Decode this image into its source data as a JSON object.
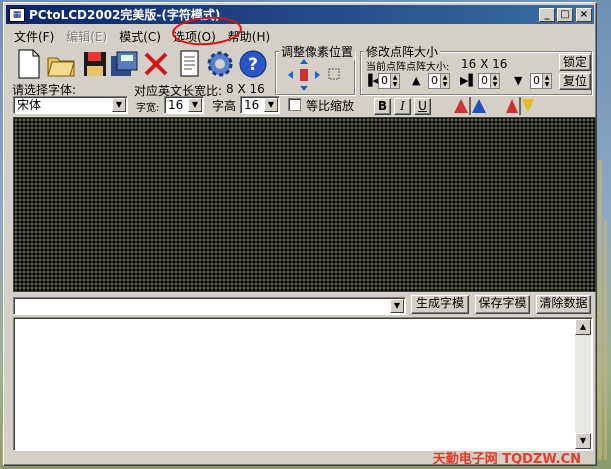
{
  "window": {
    "title": "PCtoLCD2002完美版-(字符模式)"
  },
  "titlebar": {
    "minimize": "_",
    "maximize": "□",
    "close": "×"
  },
  "menu": [
    {
      "label": "文件(F)",
      "disabled": false
    },
    {
      "label": "编辑(E)",
      "disabled": true
    },
    {
      "label": "模式(C)",
      "disabled": false
    },
    {
      "label": "选项(O)",
      "disabled": false
    },
    {
      "label": "帮助(H)",
      "disabled": false
    }
  ],
  "font_panel": {
    "select_font_label": "请选择字体:",
    "font_value": "宋体",
    "ratio_label": "对应英文长宽比:",
    "ratio_value": "8 X 16",
    "width_label": "字宽:",
    "width_value": "16",
    "height_label": "字高",
    "height_value": "16",
    "proportional_label": "等比缩放"
  },
  "adjust_panel": {
    "title": "调整像素位置"
  },
  "size_panel": {
    "title": "修改点阵大小",
    "current_label": "当前点阵点阵大小:",
    "current_value": "16 X 16",
    "lock_button": "锁定",
    "reset_button": "复位",
    "spin_values": [
      "0",
      "0",
      "0",
      "0"
    ]
  },
  "style_buttons": {
    "bold": "B",
    "italic": "I",
    "underline": "U"
  },
  "actions": {
    "generate": "生成字模",
    "save": "保存字模",
    "clear": "清除数据"
  },
  "watermark": "天勤电子网 TQDZW.CN",
  "colors": {
    "title_start": "#0a246a",
    "title_end": "#3a6ea5",
    "face": "#d4d0c8",
    "dot": "#5e6a3e",
    "annotation": "#e01010"
  }
}
